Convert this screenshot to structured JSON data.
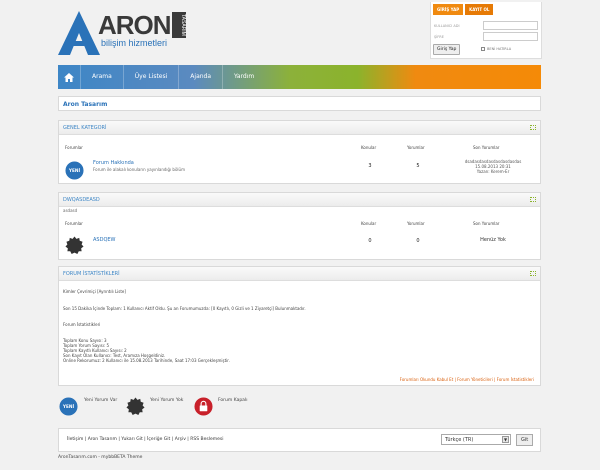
{
  "logo": {
    "word": "ARON",
    "side": "TASARIM",
    "subtitle": "bilişim hizmetleri"
  },
  "login": {
    "tab_login": "GİRİŞ YAP",
    "tab_register": "KAYIT OL",
    "username_label": "KULLANICI ADI",
    "password_label": "ŞİFRE",
    "submit": "Giriş Yap",
    "remember": "BENİ HATIRLA"
  },
  "nav": {
    "items": [
      "Arama",
      "Üye Listesi",
      "Ajanda",
      "Yardım"
    ]
  },
  "breadcrumb": "Aron Tasarım",
  "categories": [
    {
      "title": "GENEL KATEGORİ",
      "subtitle": "",
      "col_forum": "Forumlar",
      "col_topics": "Konular",
      "col_posts": "Yorumlar",
      "col_last": "Son Yorumlar",
      "forum": {
        "name": "Forum Hakkında",
        "description": "Forum ile alakalı konuların yayınlandığı bölüm",
        "topics": "3",
        "posts": "5",
        "last_title": "dsadasdasdasdasdasdasdas",
        "last_date": "15.08.2013 20:31",
        "last_author": "Yazan: Kerem-Er"
      }
    },
    {
      "title": "DWQASDEASD",
      "subtitle": "asdasd",
      "col_forum": "Forumlar",
      "col_topics": "Konular",
      "col_posts": "Yorumlar",
      "col_last": "Son Yorumlar",
      "forum": {
        "name": "ASDQEW",
        "description": "",
        "topics": "0",
        "posts": "0",
        "last_title": "Henüz Yok"
      }
    }
  ],
  "stats": {
    "title": "FORUM İSTATİSTİKLERİ",
    "online_header": "Kimler Çevrimiçi [Ayrıntılı Liste]",
    "online_line": "Son 15 Dakika İçinde Toplam: 1 Kullanıcı Aktif Oldu. Şu an Forumumuzda: [0 Kayıtlı, 0 Gizli ve 1 Ziyaretçi] Bulunmaktadır.",
    "section": "Forum İstatistikleri",
    "lines": [
      "Toplam Konu Sayısı: 3",
      "Toplam Yorum Sayısı: 5",
      "Toplam Kayıtlı Kullanıcı Sayısı: 2",
      "Son Kayıt Olan Kullanıcı: Test, Aramıza Hoşgeldiniz.",
      "Online Rekorumuz: 2 Kullanıcı ile 15.08.2013 Tarihinde, Saat 17:03 Gerçekleşmiştir."
    ],
    "footer_links": "Forumları Okundu Kabul Et | Forum Yöneticileri | Forum İstatistikleri"
  },
  "legend": {
    "new": "Yeni Yorum Var",
    "none": "Yeni Yorum Yok",
    "locked": "Forum Kapalı"
  },
  "icon_text": "YENİ",
  "footer": {
    "links": "İletişim | Aron Tasarım | Yukarı Git | İçeriğe Git | Arşiv | RSS Beslemesi",
    "language": "Türkçe (TR)",
    "go": "Git"
  },
  "copyright": "AronTasarım.com - mybbBETA Theme"
}
